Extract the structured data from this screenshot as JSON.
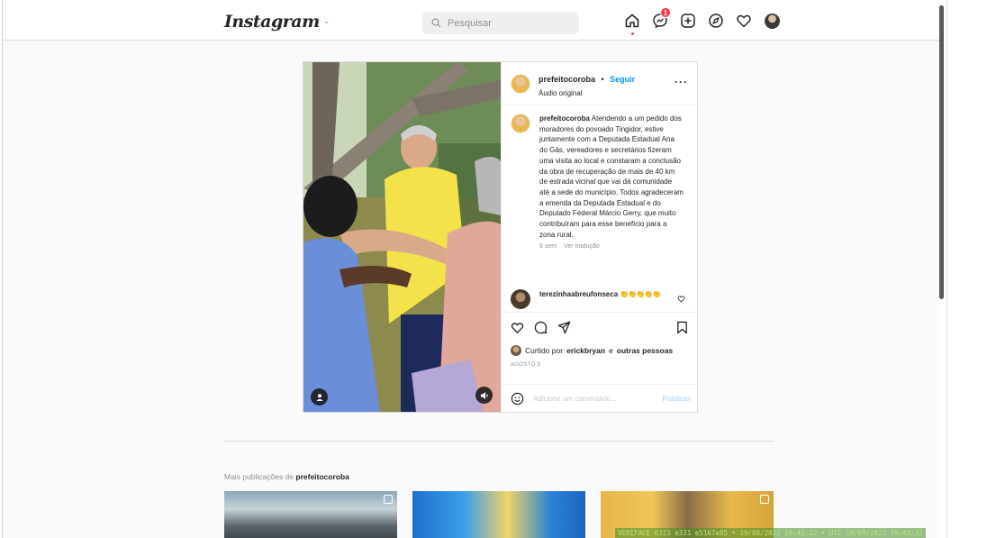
{
  "nav": {
    "logo": "Instagram",
    "search_placeholder": "Pesquisar",
    "messages_badge": "1"
  },
  "post": {
    "username": "prefeitocoroba",
    "separator": "•",
    "follow": "Seguir",
    "audio": "Áudio original",
    "more": "···",
    "caption": "Atendendo a um pedido dos moradores do povoado Tingidor, estive juntamente com a Deputada Estadual Ana do Gás, vereadores e secretários fizeram uma visita ao local e constaram a conclusão da obra de recuperação de mais de 40 km de estrada vicinal que vai dá comunidade até a sede do município. Todos agradeceram a emenda da Deputada Estadual e do Deputado Federal Márcio Gerry, que muito contribuíram para esse benefício para a zona rural.",
    "time_ago": "6 sem",
    "translate": "Ver tradução",
    "comment_user": "terezinhaabreufonseca",
    "comment_text": "👏👏👏👏👏",
    "liked_prefix": "Curtido por",
    "liked_user": "erickbryan",
    "liked_and": "e",
    "liked_others": "outras pessoas",
    "date": "AGOSTO 3",
    "comment_placeholder": "Adicione um comentário...",
    "publish": "Publicar"
  },
  "more_posts": {
    "prefix": "Mais publicações de",
    "username": "prefeitocoroba"
  },
  "watermark": "VERIFACE 6323 e331 e5167e85 • 19/09/2022 16:43:32 • UTC 19/09/2022 19:43:32",
  "colors": {
    "link_blue": "#0095f6",
    "badge_red": "#ff3040",
    "border": "#dbdbdb"
  },
  "icons": [
    "home-icon",
    "messenger-icon",
    "new-post-icon",
    "explore-icon",
    "activity-heart-icon",
    "search-icon",
    "like-icon",
    "comment-icon",
    "share-icon",
    "save-icon",
    "emoji-icon",
    "user-tag-icon",
    "mute-icon"
  ]
}
